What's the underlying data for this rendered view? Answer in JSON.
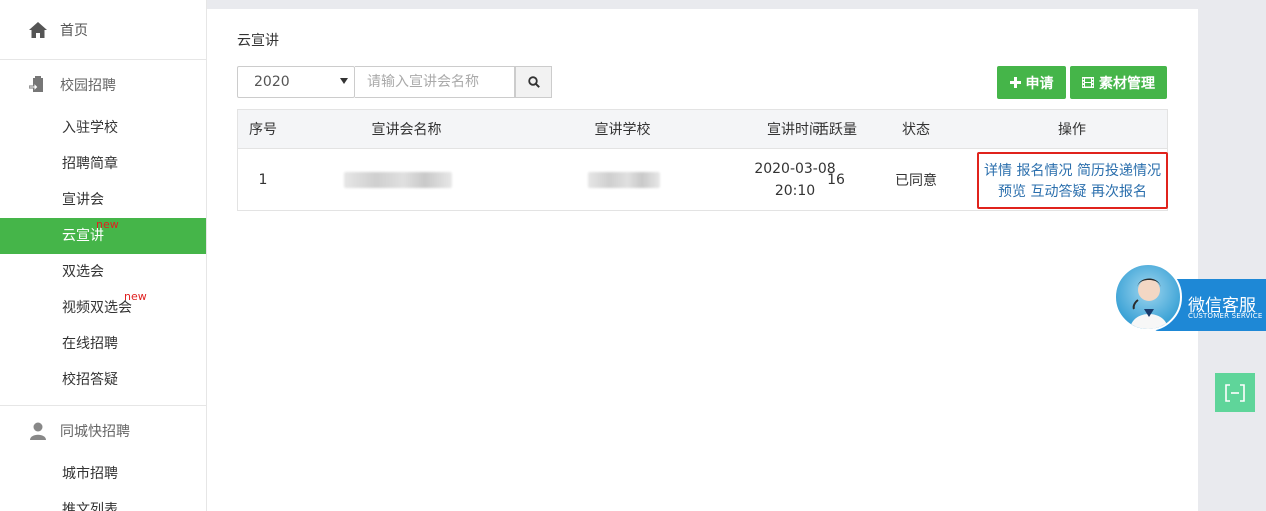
{
  "sidebar": {
    "home": "首页",
    "campus_group": "校园招聘",
    "campus_items": [
      {
        "label": "入驻学校",
        "new": ""
      },
      {
        "label": "招聘简章",
        "new": ""
      },
      {
        "label": "宣讲会",
        "new": ""
      },
      {
        "label": "云宣讲",
        "new": "new"
      },
      {
        "label": "双选会",
        "new": ""
      },
      {
        "label": "视频双选会",
        "new": "new"
      },
      {
        "label": "在线招聘",
        "new": ""
      },
      {
        "label": "校招答疑",
        "new": ""
      }
    ],
    "city_group": "同城快招聘",
    "city_items": [
      {
        "label": "城市招聘"
      },
      {
        "label": "推文列表"
      }
    ],
    "active_color": "#45b549"
  },
  "main": {
    "title": "云宣讲",
    "year_select": "2020",
    "search_placeholder": "请输入宣讲会名称",
    "apply_button": "申请",
    "material_button": "素材管理"
  },
  "table": {
    "headers": [
      "序号",
      "宣讲会名称",
      "宣讲学校",
      "宣讲时间",
      "活跃量",
      "状态",
      "操作"
    ],
    "rows": [
      {
        "no": "1",
        "date": "2020-03-08",
        "time": "20:10",
        "active": "16",
        "status": "已同意",
        "ops_line1": [
          "详情",
          "报名情况",
          "简历投递情况"
        ],
        "ops_line2": [
          "预览",
          "互动答疑",
          "再次报名"
        ]
      }
    ]
  },
  "float": {
    "wechat_title": "微信客服",
    "wechat_sub": "CUSTOMER SERVICE",
    "collapse_label": "[–]"
  },
  "icons": {
    "home": "home-icon",
    "campus": "campus-icon",
    "city": "user-icon",
    "search": "search-icon",
    "plus": "plus-icon",
    "film": "film-icon"
  }
}
